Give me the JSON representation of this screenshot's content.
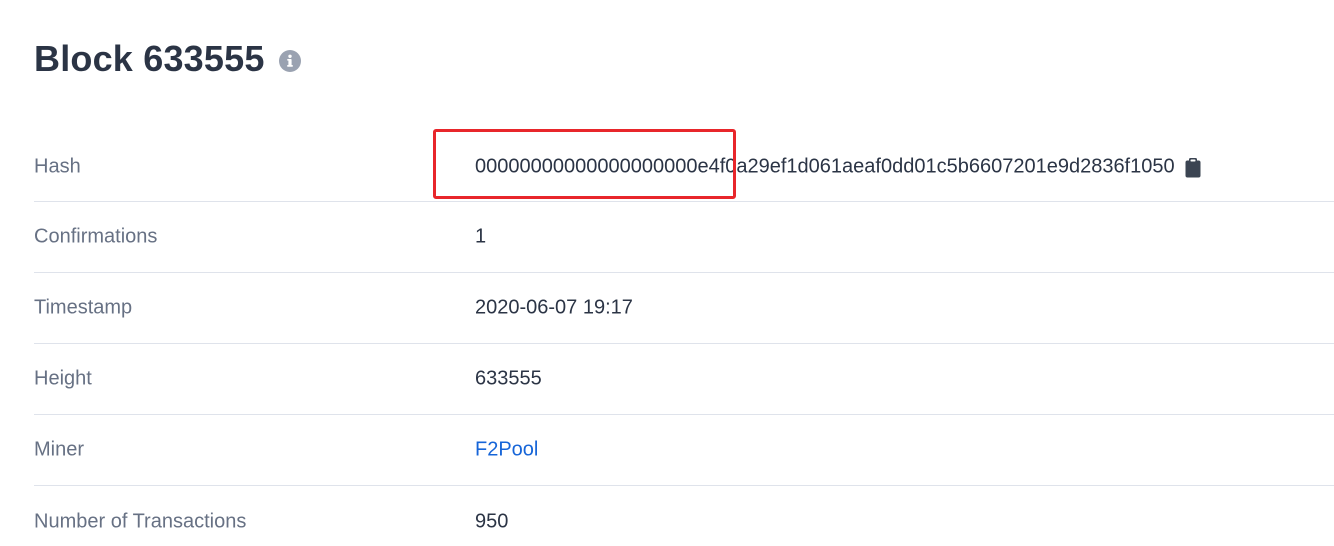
{
  "page": {
    "title": "Block 633555"
  },
  "details": {
    "hash": {
      "label": "Hash",
      "value": "00000000000000000000e4f0a29ef1d061aeaf0dd01c5b6607201e9d2836f1050"
    },
    "confirmations": {
      "label": "Confirmations",
      "value": "1"
    },
    "timestamp": {
      "label": "Timestamp",
      "value": "2020-06-07 19:17"
    },
    "height": {
      "label": "Height",
      "value": "633555"
    },
    "miner": {
      "label": "Miner",
      "value": "F2Pool"
    },
    "num_transactions": {
      "label": "Number of Transactions",
      "value": "950"
    }
  },
  "icons": {
    "info": "info-icon",
    "copy": "clipboard-icon"
  },
  "colors": {
    "title": "#2b3445",
    "label": "#677184",
    "link": "#1665d8",
    "divider": "#dfe3eb",
    "highlight": "#e8262b"
  }
}
